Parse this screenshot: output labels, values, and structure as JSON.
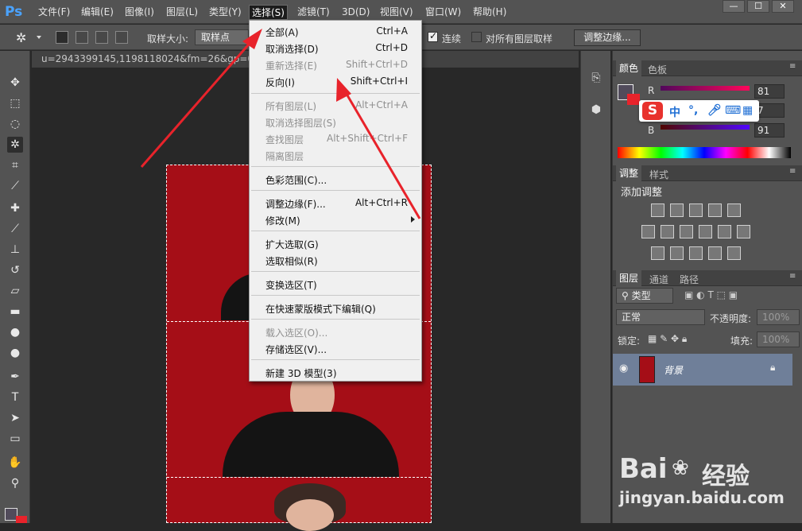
{
  "app": {
    "logo": "Ps",
    "menus": [
      "文件(F)",
      "编辑(E)",
      "图像(I)",
      "图层(L)",
      "类型(Y)",
      "选择(S)",
      "滤镜(T)",
      "3D(D)",
      "视图(V)",
      "窗口(W)",
      "帮助(H)"
    ],
    "active_menu": "选择(S)",
    "window_buttons": [
      "—",
      "☐",
      "✕"
    ]
  },
  "options_bar": {
    "sample_size_label": "取样大小:",
    "sample_size_value": "取样点",
    "contiguous_label": "连续",
    "all_layers_label": "对所有图层取样",
    "refine_edge_button": "调整边缘..."
  },
  "document": {
    "tab_title": "u=2943399145,1198118024&fm=26&gp=0.jpg"
  },
  "select_menu": {
    "items": [
      {
        "label": "全部(A)",
        "shortcut": "Ctrl+A",
        "disabled": false
      },
      {
        "label": "取消选择(D)",
        "shortcut": "Ctrl+D",
        "disabled": false
      },
      {
        "label": "重新选择(E)",
        "shortcut": "Shift+Ctrl+D",
        "disabled": true
      },
      {
        "label": "反向(I)",
        "shortcut": "Shift+Ctrl+I",
        "disabled": false
      },
      {
        "label": "所有图层(L)",
        "shortcut": "Alt+Ctrl+A",
        "disabled": true
      },
      {
        "label": "取消选择图层(S)",
        "shortcut": "",
        "disabled": true
      },
      {
        "label": "查找图层",
        "shortcut": "Alt+Shift+Ctrl+F",
        "disabled": true
      },
      {
        "label": "隔离图层",
        "shortcut": "",
        "disabled": true
      },
      {
        "label": "色彩范围(C)...",
        "shortcut": "",
        "disabled": false
      },
      {
        "label": "调整边缘(F)...",
        "shortcut": "Alt+Ctrl+R",
        "disabled": false
      },
      {
        "label": "修改(M)",
        "shortcut": "",
        "disabled": false,
        "submenu": true
      },
      {
        "label": "扩大选取(G)",
        "shortcut": "",
        "disabled": false
      },
      {
        "label": "选取相似(R)",
        "shortcut": "",
        "disabled": false
      },
      {
        "label": "变换选区(T)",
        "shortcut": "",
        "disabled": false
      },
      {
        "label": "在快速蒙版模式下编辑(Q)",
        "shortcut": "",
        "disabled": false
      },
      {
        "label": "载入选区(O)...",
        "shortcut": "",
        "disabled": true
      },
      {
        "label": "存储选区(V)...",
        "shortcut": "",
        "disabled": false
      },
      {
        "label": "新建 3D 模型(3)",
        "shortcut": "",
        "disabled": false
      }
    ]
  },
  "color_panel": {
    "tabs": [
      "颜色",
      "色板"
    ],
    "channels": [
      {
        "name": "R",
        "value": "81"
      },
      {
        "name": "G",
        "value": "7"
      },
      {
        "name": "B",
        "value": "91"
      }
    ]
  },
  "adjust_panel": {
    "tabs": [
      "调整",
      "样式"
    ],
    "title": "添加调整"
  },
  "layers_panel": {
    "tabs": [
      "图层",
      "通道",
      "路径"
    ],
    "filter_label": "类型",
    "blend_mode": "正常",
    "opacity_label": "不透明度:",
    "opacity_value": "100%",
    "lock_label": "锁定:",
    "fill_label": "填充:",
    "fill_value": "100%",
    "layer_name": "背景"
  },
  "ime": {
    "logo": "S",
    "mode": "中",
    "punct": "°,"
  },
  "watermark": {
    "brand": "Bai",
    "brand2": "经验",
    "url": "jingyan.baidu.com"
  },
  "colors": {
    "accent_red": "#e8232b",
    "image_red": "#a50e17",
    "ui_gray": "#535353"
  }
}
